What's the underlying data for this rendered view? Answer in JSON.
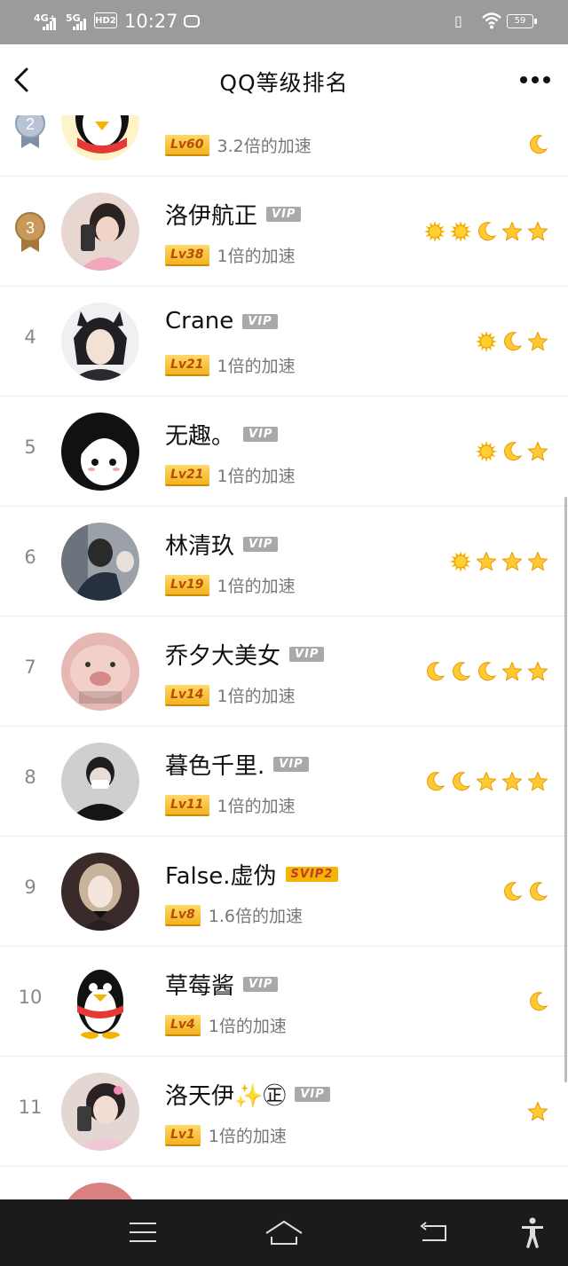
{
  "status_bar": {
    "net1": "4G+",
    "net2": "5G",
    "hd": "HD2",
    "time": "10:27",
    "battery": "59"
  },
  "header": {
    "title": "QQ等级排名"
  },
  "rows": [
    {
      "rank": "2",
      "name": "",
      "badge": "",
      "level": "Lv60",
      "speed": "3.2倍的加速",
      "icons": [
        "moon"
      ],
      "avatar": "penguin"
    },
    {
      "rank": "3",
      "name": "洛伊航正",
      "badge": "VIP",
      "level": "Lv38",
      "speed": "1倍的加速",
      "icons": [
        "sun",
        "sun",
        "moon",
        "star",
        "star"
      ],
      "avatar": "photo-pink"
    },
    {
      "rank": "4",
      "name": "Crane",
      "badge": "VIP",
      "level": "Lv21",
      "speed": "1倍的加速",
      "icons": [
        "sun",
        "moon",
        "star"
      ],
      "avatar": "anime-dark"
    },
    {
      "rank": "5",
      "name": "无趣。",
      "badge": "VIP",
      "level": "Lv21",
      "speed": "1倍的加速",
      "icons": [
        "sun",
        "moon",
        "star"
      ],
      "avatar": "anime-bw"
    },
    {
      "rank": "6",
      "name": "林清玖",
      "badge": "VIP",
      "level": "Lv19",
      "speed": "1倍的加速",
      "icons": [
        "sun",
        "star",
        "star",
        "star"
      ],
      "avatar": "photo-gray"
    },
    {
      "rank": "7",
      "name": "乔夕大美女",
      "badge": "VIP",
      "level": "Lv14",
      "speed": "1倍的加速",
      "icons": [
        "moon",
        "moon",
        "moon",
        "star",
        "star"
      ],
      "avatar": "pig"
    },
    {
      "rank": "8",
      "name": "暮色千里.",
      "badge": "VIP",
      "level": "Lv11",
      "speed": "1倍的加速",
      "icons": [
        "moon",
        "moon",
        "star",
        "star",
        "star"
      ],
      "avatar": "photo-dark"
    },
    {
      "rank": "9",
      "name": "False.虚伪",
      "badge": "SVIP2",
      "level": "Lv8",
      "speed": "1.6倍的加速",
      "icons": [
        "moon",
        "moon"
      ],
      "avatar": "anime-girl"
    },
    {
      "rank": "10",
      "name": "草莓酱",
      "badge": "VIP",
      "level": "Lv4",
      "speed": "1倍的加速",
      "icons": [
        "moon"
      ],
      "avatar": "penguin-plain"
    },
    {
      "rank": "11",
      "name": "洛天伊✨㊣",
      "badge": "VIP",
      "level": "Lv1",
      "speed": "1倍的加速",
      "icons": [
        "star"
      ],
      "avatar": "photo-pink2"
    }
  ],
  "colors": {
    "status_bg": "#9b9b9b",
    "level_gold": "#f2b320",
    "vip_gray": "#a9a9a9",
    "svip_gold": "#f4b400",
    "sysbar_bg": "#1b1b1b"
  }
}
